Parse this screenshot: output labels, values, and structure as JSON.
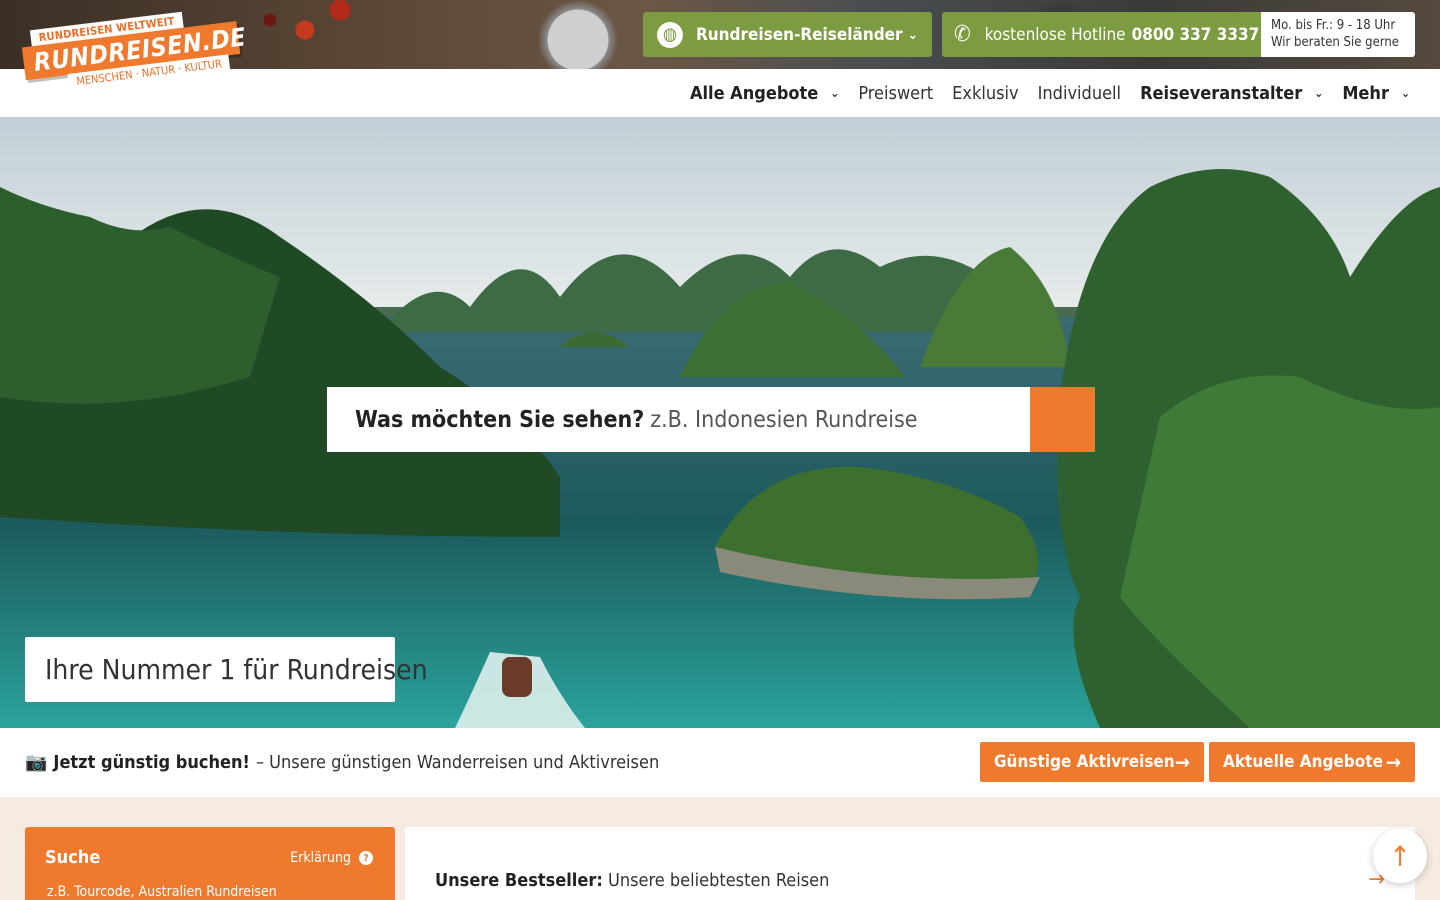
{
  "logo": {
    "top": "RUNDREISEN WELTWEIT",
    "main": "RUNDREISEN.DE",
    "sub": "MENSCHEN · NATUR · KULTUR"
  },
  "topbar": {
    "countries_label": "Rundreisen-Reiseländer",
    "hotline_label": "kostenlose Hotline",
    "hotline_number": "0800 337 3337",
    "hours_line1": "Mo. bis Fr.: 9 - 18 Uhr",
    "hours_line2": "Wir beraten Sie gerne"
  },
  "nav": {
    "items": [
      {
        "label": "Alle Angebote"
      },
      {
        "label": "Preiswert"
      },
      {
        "label": "Exklusiv"
      },
      {
        "label": "Individuell"
      },
      {
        "label": "Reiseveranstalter"
      },
      {
        "label": "Mehr"
      }
    ]
  },
  "hero": {
    "search_prompt": "Was möchten Sie sehen?",
    "search_placeholder": "z.B. Indonesien Rundreise",
    "tagline": "Ihre Nummer 1 für Rundreisen"
  },
  "promo": {
    "bold": "Jetzt günstig buchen!",
    "text": "– Unsere günstigen Wanderreisen und Aktivreisen",
    "button1": "Günstige Aktivreisen",
    "button2": "Aktuelle Angebote"
  },
  "search_panel": {
    "title": "Suche",
    "explain": "Erklärung",
    "placeholder": "z.B. Tourcode, Australien Rundreisen"
  },
  "bestseller": {
    "bold": "Unsere Bestseller:",
    "text": "Unsere beliebtesten Reisen"
  },
  "colors": {
    "accent": "#ef7a2e",
    "green": "#7d9c41"
  }
}
